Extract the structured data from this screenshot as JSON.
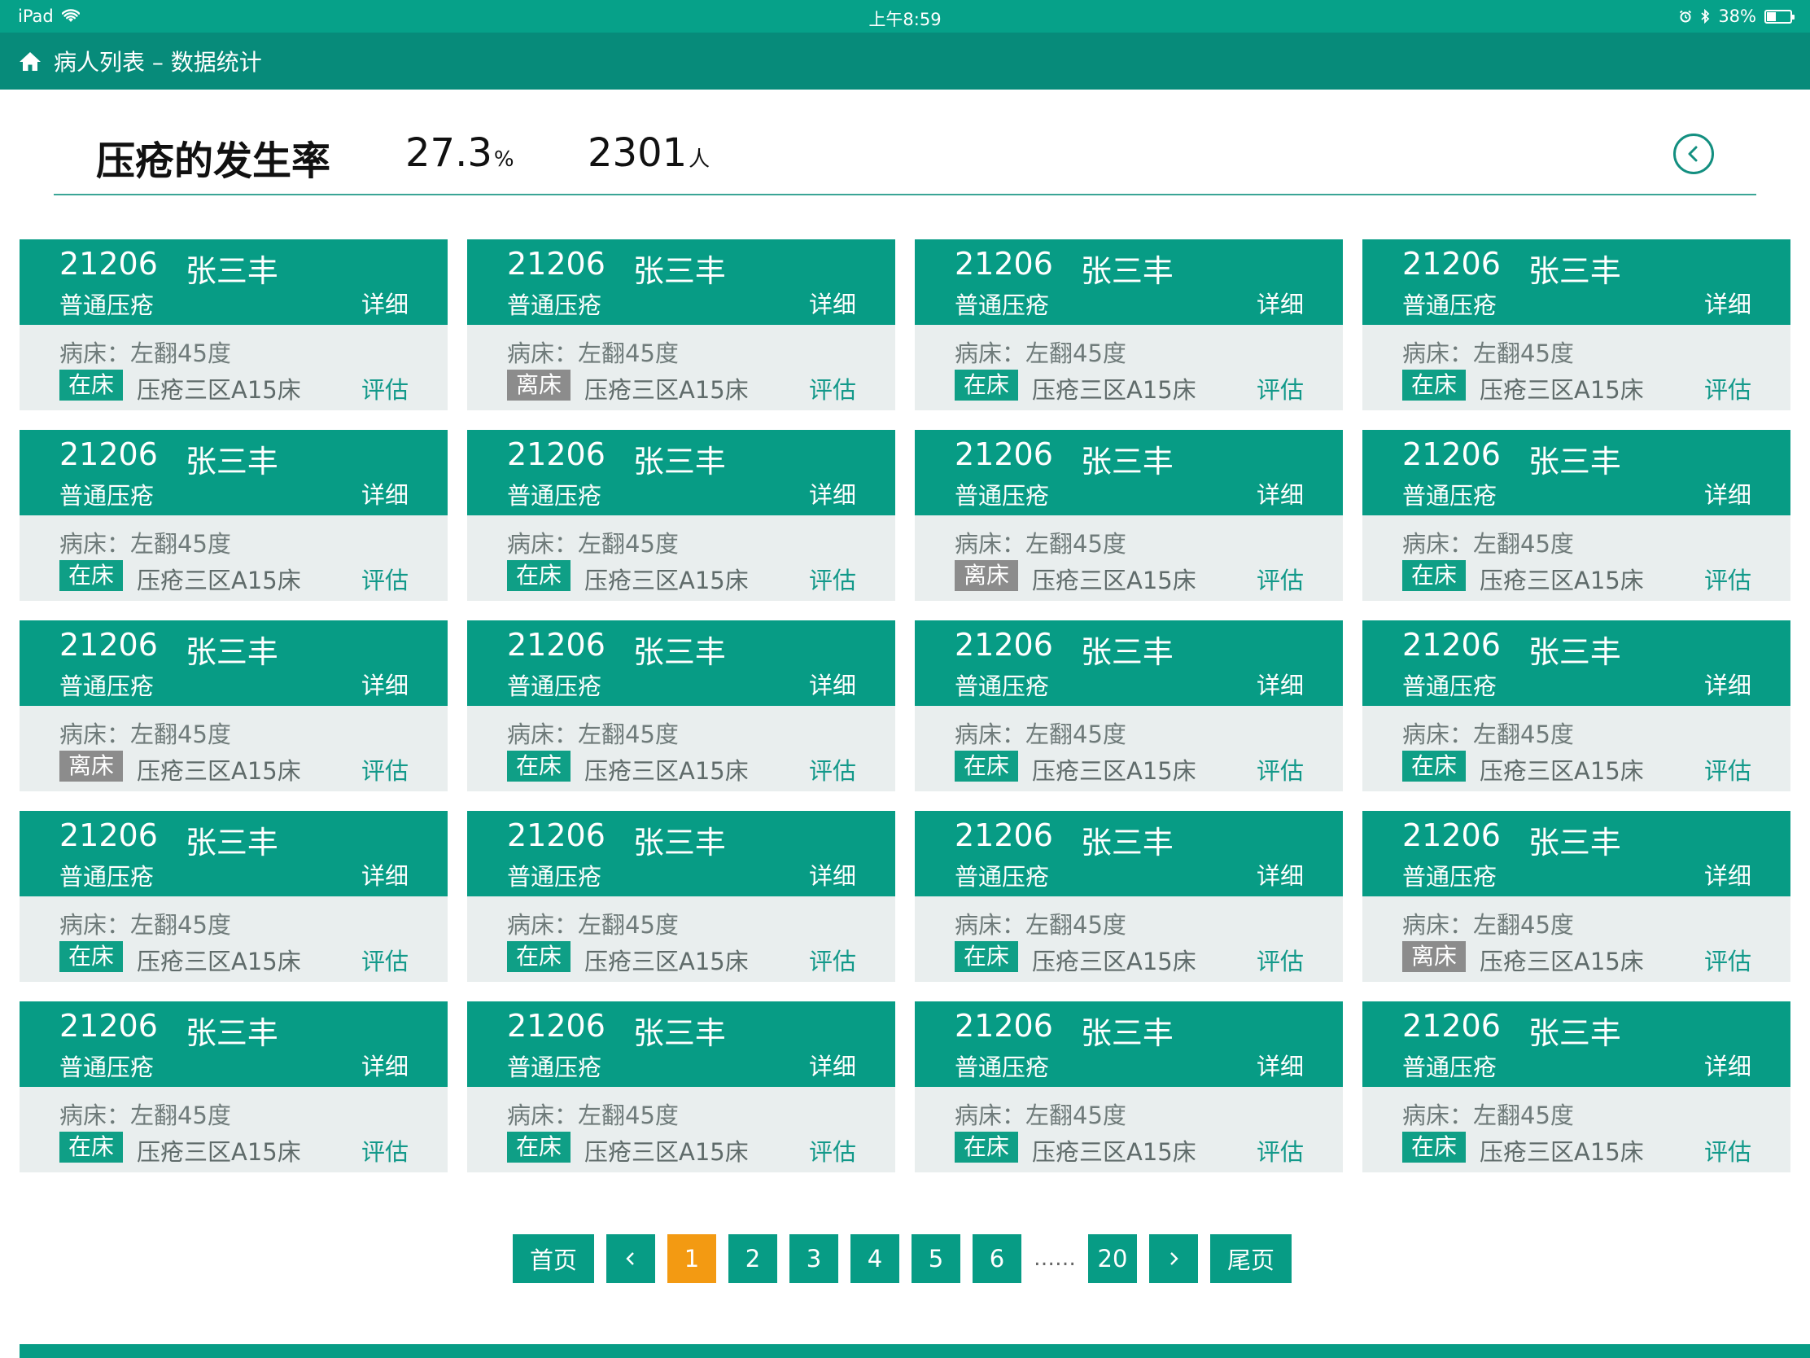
{
  "statusbar": {
    "device": "iPad",
    "time": "上午8:59",
    "battery_percent": "38%",
    "battery_level": 0.38
  },
  "navbar": {
    "title": "病人列表 – 数据统计"
  },
  "stats": {
    "title": "压疮的发生率",
    "rate_value": "27.3",
    "rate_unit": "%",
    "count_value": "2301",
    "count_unit": "人"
  },
  "colors": {
    "primary": "#079c85",
    "header": "#078b7a",
    "active_page": "#f39a12",
    "off_bed": "#8c8c8c",
    "card_bg": "#e9eeee"
  },
  "cards": [
    {
      "room_no": "21206",
      "name": "张三丰",
      "type": "普通压疮",
      "detail": "详细",
      "bed": "病床：左翻45度",
      "status": "在床",
      "location": "压疮三区A15床",
      "assess": "评估"
    },
    {
      "room_no": "21206",
      "name": "张三丰",
      "type": "普通压疮",
      "detail": "详细",
      "bed": "病床：左翻45度",
      "status": "离床",
      "location": "压疮三区A15床",
      "assess": "评估"
    },
    {
      "room_no": "21206",
      "name": "张三丰",
      "type": "普通压疮",
      "detail": "详细",
      "bed": "病床：左翻45度",
      "status": "在床",
      "location": "压疮三区A15床",
      "assess": "评估"
    },
    {
      "room_no": "21206",
      "name": "张三丰",
      "type": "普通压疮",
      "detail": "详细",
      "bed": "病床：左翻45度",
      "status": "在床",
      "location": "压疮三区A15床",
      "assess": "评估"
    },
    {
      "room_no": "21206",
      "name": "张三丰",
      "type": "普通压疮",
      "detail": "详细",
      "bed": "病床：左翻45度",
      "status": "在床",
      "location": "压疮三区A15床",
      "assess": "评估"
    },
    {
      "room_no": "21206",
      "name": "张三丰",
      "type": "普通压疮",
      "detail": "详细",
      "bed": "病床：左翻45度",
      "status": "在床",
      "location": "压疮三区A15床",
      "assess": "评估"
    },
    {
      "room_no": "21206",
      "name": "张三丰",
      "type": "普通压疮",
      "detail": "详细",
      "bed": "病床：左翻45度",
      "status": "离床",
      "location": "压疮三区A15床",
      "assess": "评估"
    },
    {
      "room_no": "21206",
      "name": "张三丰",
      "type": "普通压疮",
      "detail": "详细",
      "bed": "病床：左翻45度",
      "status": "在床",
      "location": "压疮三区A15床",
      "assess": "评估"
    },
    {
      "room_no": "21206",
      "name": "张三丰",
      "type": "普通压疮",
      "detail": "详细",
      "bed": "病床：左翻45度",
      "status": "离床",
      "location": "压疮三区A15床",
      "assess": "评估"
    },
    {
      "room_no": "21206",
      "name": "张三丰",
      "type": "普通压疮",
      "detail": "详细",
      "bed": "病床：左翻45度",
      "status": "在床",
      "location": "压疮三区A15床",
      "assess": "评估"
    },
    {
      "room_no": "21206",
      "name": "张三丰",
      "type": "普通压疮",
      "detail": "详细",
      "bed": "病床：左翻45度",
      "status": "在床",
      "location": "压疮三区A15床",
      "assess": "评估"
    },
    {
      "room_no": "21206",
      "name": "张三丰",
      "type": "普通压疮",
      "detail": "详细",
      "bed": "病床：左翻45度",
      "status": "在床",
      "location": "压疮三区A15床",
      "assess": "评估"
    },
    {
      "room_no": "21206",
      "name": "张三丰",
      "type": "普通压疮",
      "detail": "详细",
      "bed": "病床：左翻45度",
      "status": "在床",
      "location": "压疮三区A15床",
      "assess": "评估"
    },
    {
      "room_no": "21206",
      "name": "张三丰",
      "type": "普通压疮",
      "detail": "详细",
      "bed": "病床：左翻45度",
      "status": "在床",
      "location": "压疮三区A15床",
      "assess": "评估"
    },
    {
      "room_no": "21206",
      "name": "张三丰",
      "type": "普通压疮",
      "detail": "详细",
      "bed": "病床：左翻45度",
      "status": "在床",
      "location": "压疮三区A15床",
      "assess": "评估"
    },
    {
      "room_no": "21206",
      "name": "张三丰",
      "type": "普通压疮",
      "detail": "详细",
      "bed": "病床：左翻45度",
      "status": "离床",
      "location": "压疮三区A15床",
      "assess": "评估"
    },
    {
      "room_no": "21206",
      "name": "张三丰",
      "type": "普通压疮",
      "detail": "详细",
      "bed": "病床：左翻45度",
      "status": "在床",
      "location": "压疮三区A15床",
      "assess": "评估"
    },
    {
      "room_no": "21206",
      "name": "张三丰",
      "type": "普通压疮",
      "detail": "详细",
      "bed": "病床：左翻45度",
      "status": "在床",
      "location": "压疮三区A15床",
      "assess": "评估"
    },
    {
      "room_no": "21206",
      "name": "张三丰",
      "type": "普通压疮",
      "detail": "详细",
      "bed": "病床：左翻45度",
      "status": "在床",
      "location": "压疮三区A15床",
      "assess": "评估"
    },
    {
      "room_no": "21206",
      "name": "张三丰",
      "type": "普通压疮",
      "detail": "详细",
      "bed": "病床：左翻45度",
      "status": "在床",
      "location": "压疮三区A15床",
      "assess": "评估"
    }
  ],
  "pagination": {
    "first": "首页",
    "last": "尾页",
    "pages": [
      "1",
      "2",
      "3",
      "4",
      "5",
      "6"
    ],
    "ellipsis": "……",
    "final_page": "20",
    "current": "1"
  }
}
